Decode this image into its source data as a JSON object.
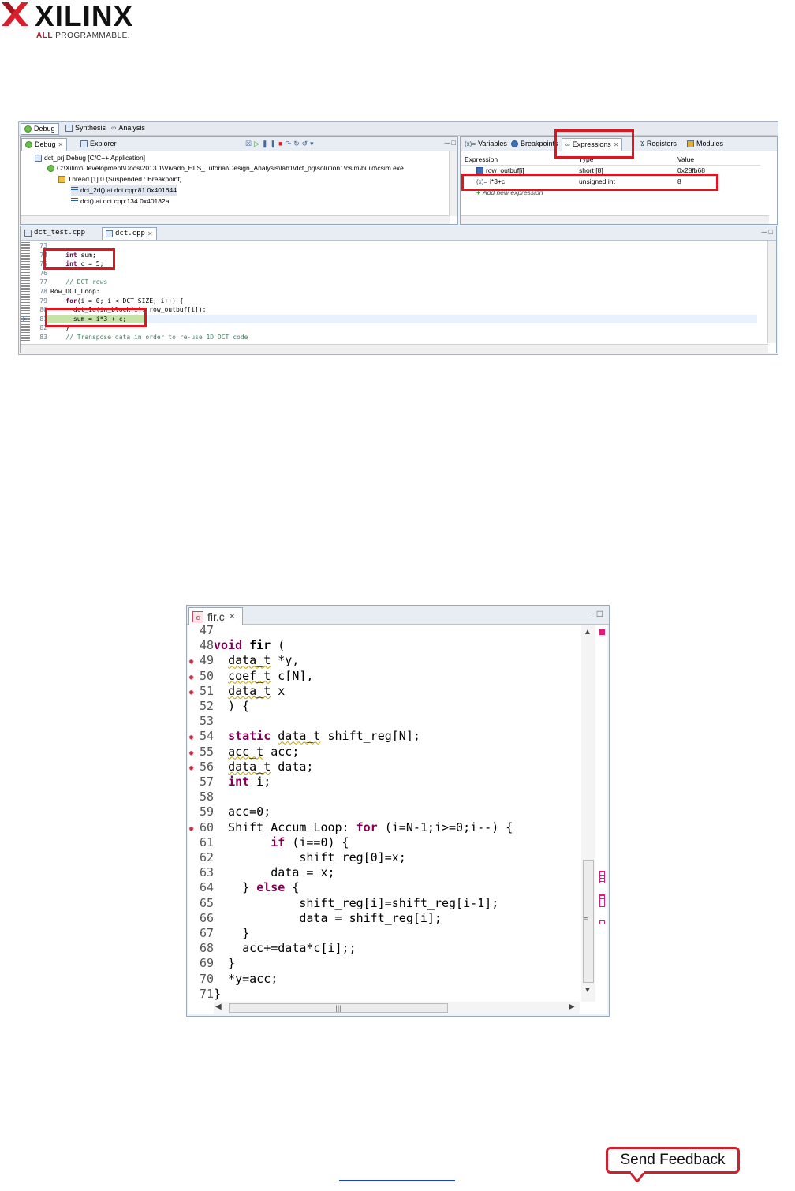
{
  "logo": {
    "brand": "XILINX",
    "tag_all": "ALL",
    "tag_rest": " PROGRAMMABLE."
  },
  "ide": {
    "perspectives": [
      "Debug",
      "Synthesis",
      "Analysis"
    ],
    "debug_view": {
      "tabs": [
        "Debug",
        "Explorer"
      ],
      "tree": [
        "dct_prj.Debug [C/C++ Application]",
        "C:\\Xilinx\\Development\\Docs\\2013.1\\Vivado_HLS_Tutorial\\Design_Analysis\\lab1\\dct_prj\\solution1\\csim\\build\\csim.exe",
        "Thread [1] 0 (Suspended : Breakpoint)",
        "dct_2d() at dct.cpp:81 0x401644",
        "dct() at dct.cpp:134 0x40182a"
      ]
    },
    "expr_view": {
      "tabs": [
        "Variables",
        "Breakpoints",
        "Expressions",
        "Registers",
        "Modules"
      ],
      "columns": [
        "Expression",
        "Type",
        "Value"
      ],
      "rows": [
        [
          "row_outbuf[i]",
          "short [8]",
          "0x28fb68"
        ],
        [
          "i*3+c",
          "unsigned int",
          "8"
        ]
      ],
      "add_new": "Add new expression"
    },
    "editor": {
      "tabs": [
        "dct_test.cpp",
        "dct.cpp"
      ],
      "lines": [
        {
          "n": "73",
          "t": ""
        },
        {
          "n": "74",
          "t": "    int sum;"
        },
        {
          "n": "75",
          "t": "    int c = 5;"
        },
        {
          "n": "76",
          "t": ""
        },
        {
          "n": "77",
          "t": "    // DCT rows"
        },
        {
          "n": "78",
          "t": "Row_DCT_Loop:"
        },
        {
          "n": "79",
          "t": "    for(i = 0; i < DCT_SIZE; i++) {"
        },
        {
          "n": "80",
          "t": "      dct_1d(in_block[i], row_outbuf[i]);"
        },
        {
          "n": "81",
          "t": "      sum = i*3 + c;"
        },
        {
          "n": "82",
          "t": "    }"
        },
        {
          "n": "83",
          "t": "    // Transpose data in order to re-use 1D DCT code"
        }
      ]
    }
  },
  "fir_editor": {
    "tab": "fir.c",
    "lines": [
      {
        "n": "47",
        "t": ""
      },
      {
        "n": "48",
        "t": "void fir ("
      },
      {
        "n": "49",
        "t": "  data_t *y,"
      },
      {
        "n": "50",
        "t": "  coef_t c[N],"
      },
      {
        "n": "51",
        "t": "  data_t x"
      },
      {
        "n": "52",
        "t": "  ) {"
      },
      {
        "n": "53",
        "t": ""
      },
      {
        "n": "54",
        "t": "  static data_t shift_reg[N];"
      },
      {
        "n": "55",
        "t": "  acc_t acc;"
      },
      {
        "n": "56",
        "t": "  data_t data;"
      },
      {
        "n": "57",
        "t": "  int i;"
      },
      {
        "n": "58",
        "t": ""
      },
      {
        "n": "59",
        "t": "  acc=0;"
      },
      {
        "n": "60",
        "t": "  Shift_Accum_Loop: for (i=N-1;i>=0;i--) {"
      },
      {
        "n": "61",
        "t": "        if (i==0) {"
      },
      {
        "n": "62",
        "t": "            shift_reg[0]=x;"
      },
      {
        "n": "63",
        "t": "        data = x;"
      },
      {
        "n": "64",
        "t": "    } else {"
      },
      {
        "n": "65",
        "t": "            shift_reg[i]=shift_reg[i-1];"
      },
      {
        "n": "66",
        "t": "            data = shift_reg[i];"
      },
      {
        "n": "67",
        "t": "    }"
      },
      {
        "n": "68",
        "t": "    acc+=data*c[i];;"
      },
      {
        "n": "69",
        "t": "  }"
      },
      {
        "n": "70",
        "t": "  *y=acc;"
      },
      {
        "n": "71",
        "t": "}"
      }
    ]
  },
  "feedback": {
    "label": "Send Feedback"
  },
  "colors": {
    "brand_red": "#e0141e",
    "keyword": "#7f0055",
    "comment": "#3f7f5f"
  }
}
